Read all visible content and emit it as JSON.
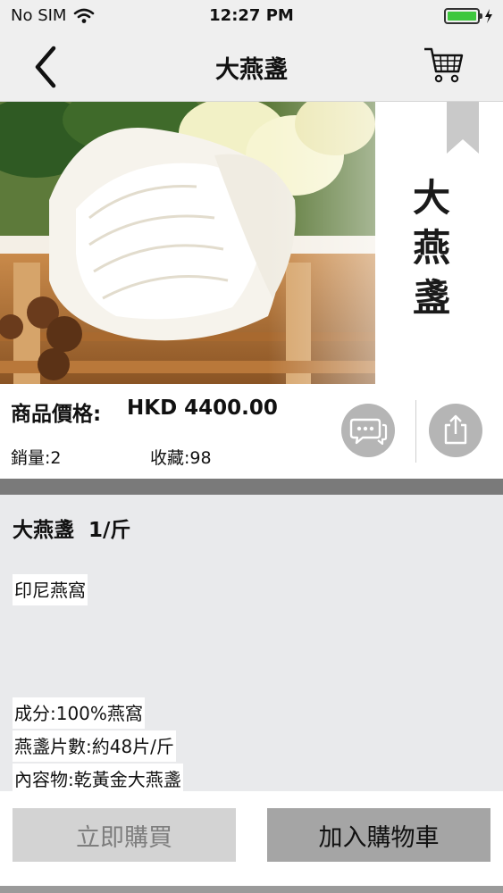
{
  "status_bar": {
    "carrier": "No SIM",
    "time": "12:27 PM",
    "battery_level": 1.0,
    "icons": [
      "wifi-icon",
      "battery-icon",
      "charging-icon"
    ]
  },
  "nav": {
    "title": "大燕盞",
    "back_icon": "chevron-left-icon",
    "cart_icon": "shopping-cart-icon"
  },
  "hero": {
    "caption": "大燕盞",
    "caption_lines": [
      "大",
      "燕",
      "盞"
    ]
  },
  "product": {
    "price_label": "商品價格:",
    "price_value": "HKD 4400.00",
    "sales": "銷量:2",
    "favorites": "收藏:98",
    "chat_icon": "chat-bubbles-icon",
    "share_icon": "share-icon"
  },
  "description": {
    "title": "大燕盞  1/斤",
    "lines": [
      "印尼燕窩",
      "成分:100%燕窩",
      "燕盞片數:約48片/斤",
      "內容物:乾黃金大燕盞"
    ]
  },
  "actions": {
    "buy_now": "立即購買",
    "add_to_cart": "加入購物車"
  },
  "colors": {
    "nav_bg": "#efefef",
    "desc_bg": "#e9eaec",
    "buy_btn": "#d3d3d3",
    "cart_btn": "#a5a5a5",
    "icon_circle": "#b5b5b5",
    "battery": "#3ec73e"
  }
}
